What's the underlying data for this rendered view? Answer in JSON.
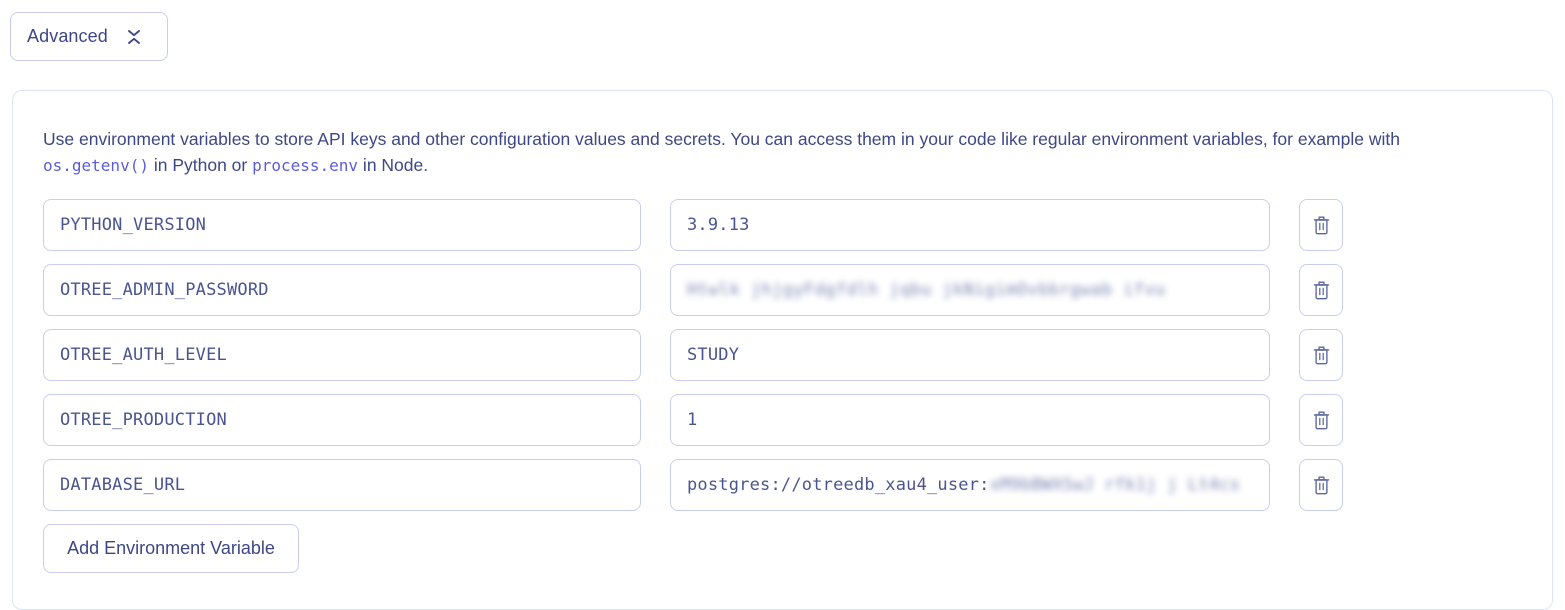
{
  "advanced": {
    "label": "Advanced",
    "icon": "collapse-icon"
  },
  "card": {
    "intro": {
      "part1": "Use environment variables to store API keys and other configuration values and secrets. You can access them in your code like regular environment variables, for example with ",
      "code1": "os.getenv()",
      "part2": " in Python or ",
      "code2": "process.env",
      "part3": " in Node."
    },
    "env_vars": [
      {
        "key": "PYTHON_VERSION",
        "value": "3.9.13",
        "secret": false,
        "delete_icon": "trash-icon"
      },
      {
        "key": "OTREE_ADMIN_PASSWORD",
        "value": "Htwlk jhjgyFdgfdlh jqbu jkNigimOvbbrgwab ifvu",
        "secret": true,
        "delete_icon": "trash-icon"
      },
      {
        "key": "OTREE_AUTH_LEVEL",
        "value": "STUDY",
        "secret": false,
        "delete_icon": "trash-icon"
      },
      {
        "key": "OTREE_PRODUCTION",
        "value": "1",
        "secret": false,
        "delete_icon": "trash-icon"
      },
      {
        "key": "DATABASE_URL",
        "value": "postgres://otreedb_xau4_user:",
        "secret_suffix": "xM9bBWXSwJ rfk1j j Lt4cs",
        "secret": false,
        "delete_icon": "trash-icon"
      }
    ],
    "add_button": {
      "label": "Add Environment Variable"
    }
  },
  "colors": {
    "text": "#3d4785",
    "code": "#5d5dd6",
    "border": "#c7cef0",
    "card_border": "#dde3f5",
    "background": "#ffffff"
  }
}
